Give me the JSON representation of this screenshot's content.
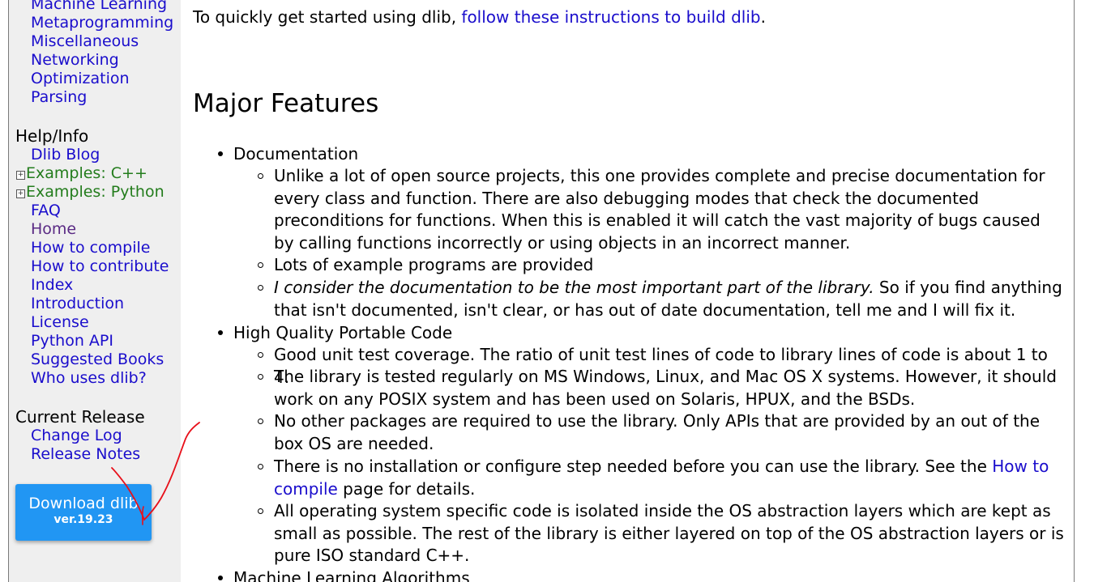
{
  "sidebar": {
    "libs_links": [
      "Machine Learning",
      "Metaprogramming",
      "Miscellaneous",
      "Networking",
      "Optimization",
      "Parsing"
    ],
    "help_heading": "Help/Info",
    "help_links": {
      "blog": "Dlib Blog",
      "examples_cpp": "Examples: C++",
      "examples_python": "Examples: Python",
      "faq": "FAQ",
      "home": "Home",
      "how_to_compile": "How to compile",
      "how_to_contribute": "How to contribute",
      "index": "Index",
      "introduction": "Introduction",
      "license": "License",
      "python_api": "Python API",
      "suggested_books": "Suggested Books",
      "who_uses": "Who uses dlib?"
    },
    "release_heading": "Current Release",
    "release_links": {
      "change_log": "Change Log",
      "release_notes": "Release Notes"
    },
    "download": {
      "label": "Download dlib",
      "version": "ver.19.23"
    },
    "colors": {
      "link": "#1a0dcc",
      "expandable": "#237c1c",
      "visited": "#5a2a84",
      "download_bg": "#2196f3"
    }
  },
  "main": {
    "intro": {
      "prefix": "To quickly get started using dlib, ",
      "link": "follow these instructions to build dlib",
      "suffix": "."
    },
    "heading": "Major Features",
    "documentation": {
      "title": "Documentation",
      "item1": "Unlike a lot of open source projects, this one provides complete and precise documentation for every class and function. There are also debugging modes that check the documented preconditions for functions. When this is enabled it will catch the vast majority of bugs caused by calling functions incorrectly or using objects in an incorrect manner.",
      "item2": "Lots of example programs are provided",
      "item3_em": "I consider the documentation to be the most important part of the library.",
      "item3_rest": " So if you find anything that isn't documented, isn't clear, or has out of date documentation, tell me and I will fix it."
    },
    "portable": {
      "title": "High Quality Portable Code",
      "item1": "Good unit test coverage. The ratio of unit test lines of code to library lines of code is about 1 to 4.",
      "item2": "The library is tested regularly on MS Windows, Linux, and Mac OS X systems. However, it should work on any POSIX system and has been used on Solaris, HPUX, and the BSDs.",
      "item3": "No other packages are required to use the library. Only APIs that are provided by an out of the box OS are needed.",
      "item4_prefix": "There is no installation or configure step needed before you can use the library. See the ",
      "item4_link": "How to compile",
      "item4_suffix": " page for details.",
      "item5": "All operating system specific code is isolated inside the OS abstraction layers which are kept as small as possible. The rest of the library is either layered on top of the OS abstraction layers or is pure ISO standard C++."
    },
    "ml": {
      "title": "Machine Learning Algorithms"
    }
  },
  "annotation": {
    "icon": "red-pen-arrow-icon",
    "color": "#e8101a"
  }
}
